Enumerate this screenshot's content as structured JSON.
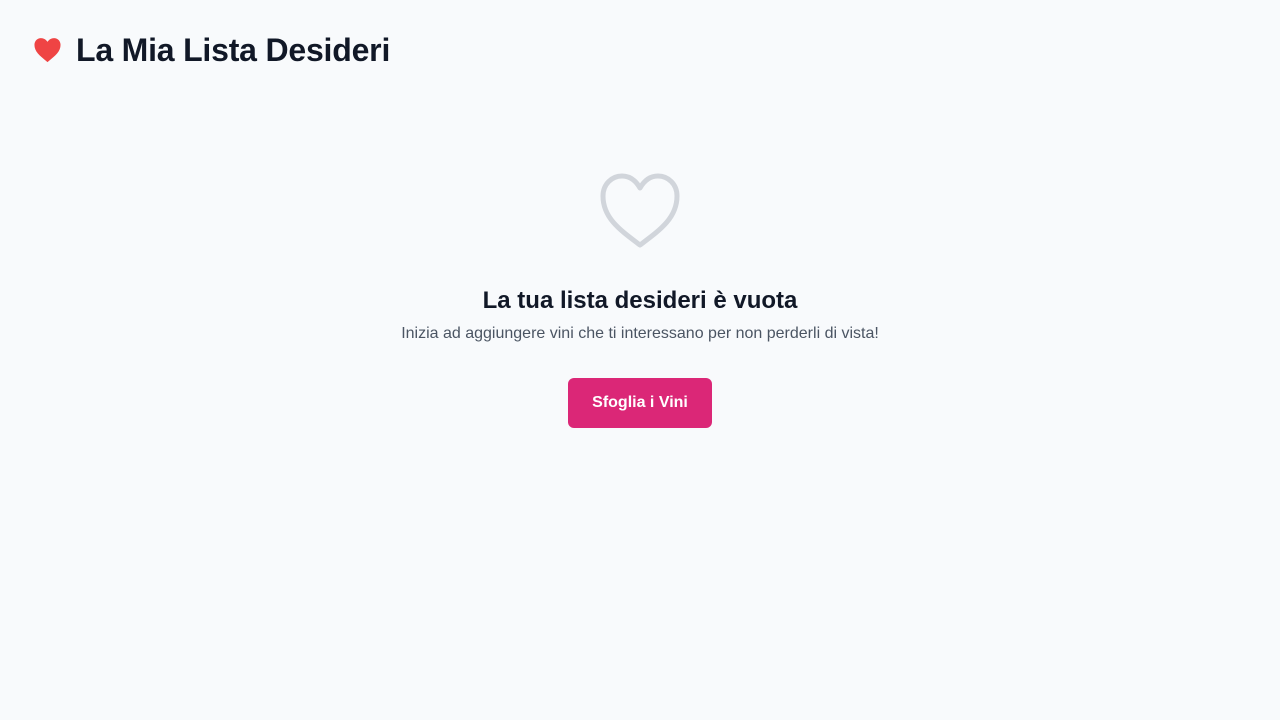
{
  "header": {
    "icon": "heart-icon",
    "icon_color": "#ef4444",
    "title": "La Mia Lista Desideri"
  },
  "empty_state": {
    "icon": "heart-outline-icon",
    "icon_color": "#d1d5db",
    "title": "La tua lista desideri è vuota",
    "subtitle": "Inizia ad aggiungere vini che ti interessano per non perderli di vista!",
    "button_label": "Sfoglia i Vini",
    "button_color": "#db2777"
  }
}
